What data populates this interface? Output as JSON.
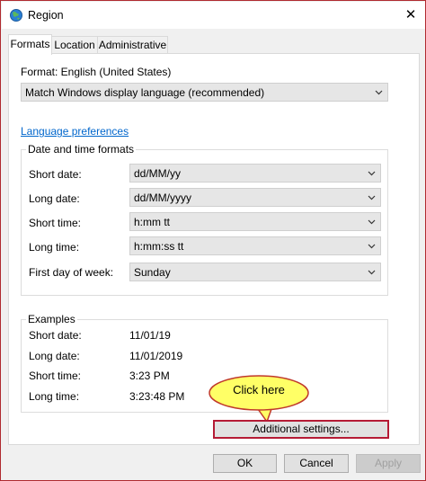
{
  "window": {
    "title": "Region",
    "close_glyph": "✕"
  },
  "tabs": [
    {
      "label": "Formats",
      "active": true
    },
    {
      "label": "Location",
      "active": false
    },
    {
      "label": "Administrative",
      "active": false
    }
  ],
  "format": {
    "label": "Format: English (United States)",
    "selected": "Match Windows display language (recommended)"
  },
  "language_link": "Language preferences",
  "date_time": {
    "title": "Date and time formats",
    "rows": [
      {
        "label": "Short date:",
        "value": "dd/MM/yy"
      },
      {
        "label": "Long date:",
        "value": "dd/MM/yyyy"
      },
      {
        "label": "Short time:",
        "value": "h:mm tt"
      },
      {
        "label": "Long time:",
        "value": "h:mm:ss tt"
      },
      {
        "label": "First day of week:",
        "value": "Sunday"
      }
    ]
  },
  "examples": {
    "title": "Examples",
    "rows": [
      {
        "label": "Short date:",
        "value": "11/01/19"
      },
      {
        "label": "Long date:",
        "value": "11/01/2019"
      },
      {
        "label": "Short time:",
        "value": "3:23 PM"
      },
      {
        "label": "Long time:",
        "value": "3:23:48 PM"
      }
    ]
  },
  "callout": {
    "text": "Click here",
    "fill": "#ffff66",
    "stroke": "#c0392b"
  },
  "additional_settings": "Additional settings...",
  "buttons": {
    "ok": "OK",
    "cancel": "Cancel",
    "apply": "Apply"
  },
  "colors": {
    "link": "#0066cc",
    "highlight_border": "#b51b35"
  }
}
